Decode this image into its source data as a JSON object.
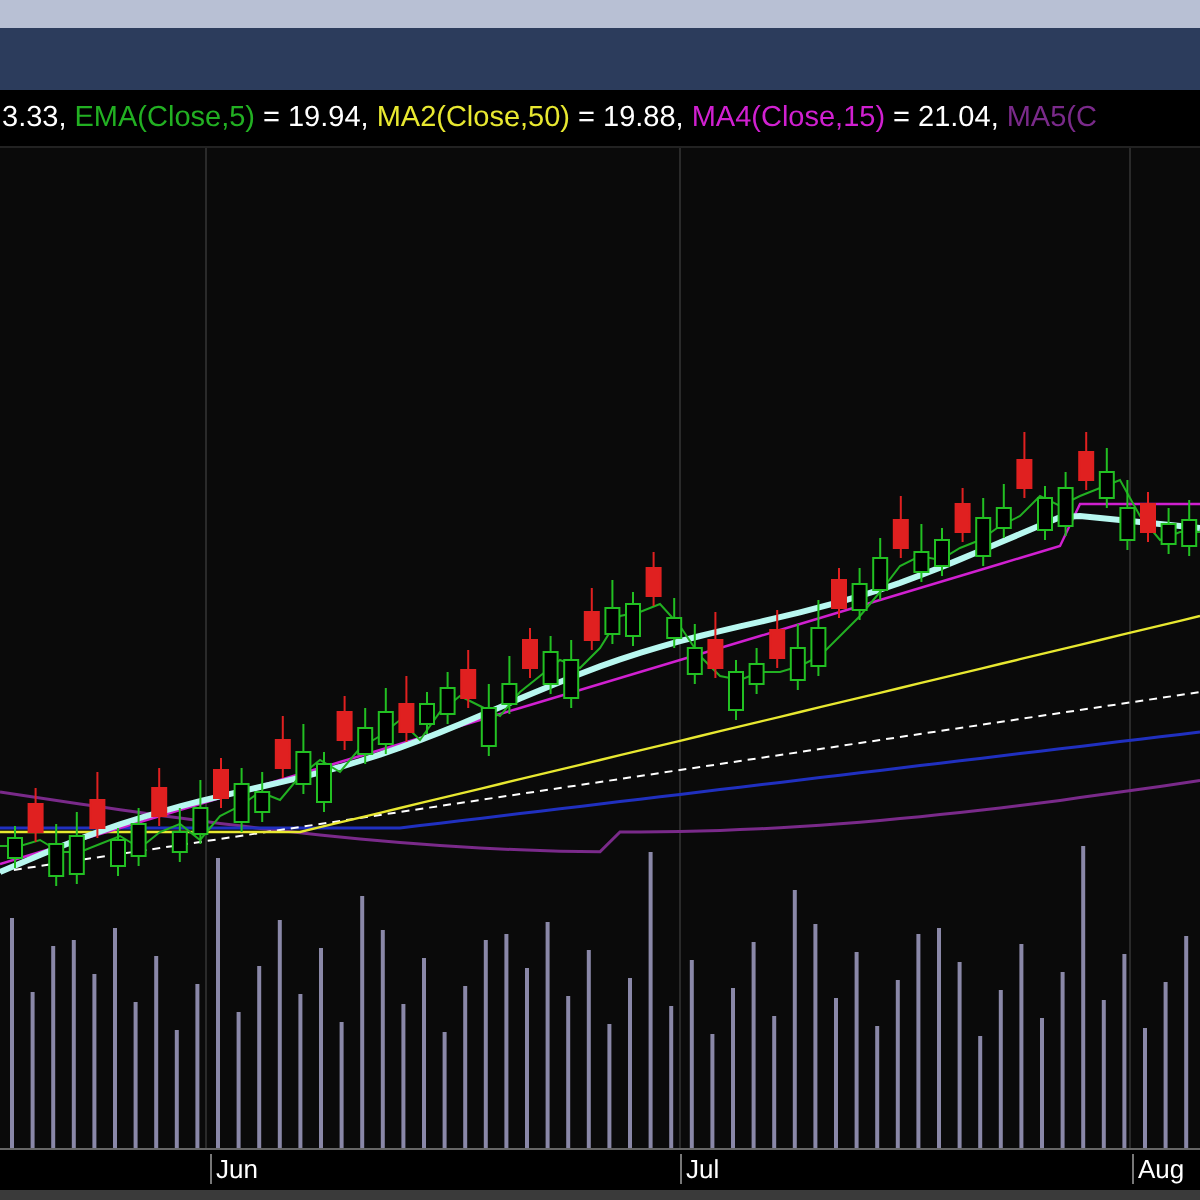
{
  "legend": [
    {
      "text": "3.33,",
      "color": "#ffffff"
    },
    {
      "text": "EMA(Close,5)",
      "color": "#22b022"
    },
    {
      "text": "= 19.94,",
      "color": "#ffffff"
    },
    {
      "text": "MA2(Close,50)",
      "color": "#e8e830"
    },
    {
      "text": "= 19.88,",
      "color": "#ffffff"
    },
    {
      "text": "MA4(Close,15)",
      "color": "#d020d0"
    },
    {
      "text": "= 21.04,",
      "color": "#ffffff"
    },
    {
      "text": "MA5(C",
      "color": "#7a2a8a"
    }
  ],
  "x_axis": {
    "labels": [
      "Jun",
      "Jul",
      "Aug"
    ]
  }
}
